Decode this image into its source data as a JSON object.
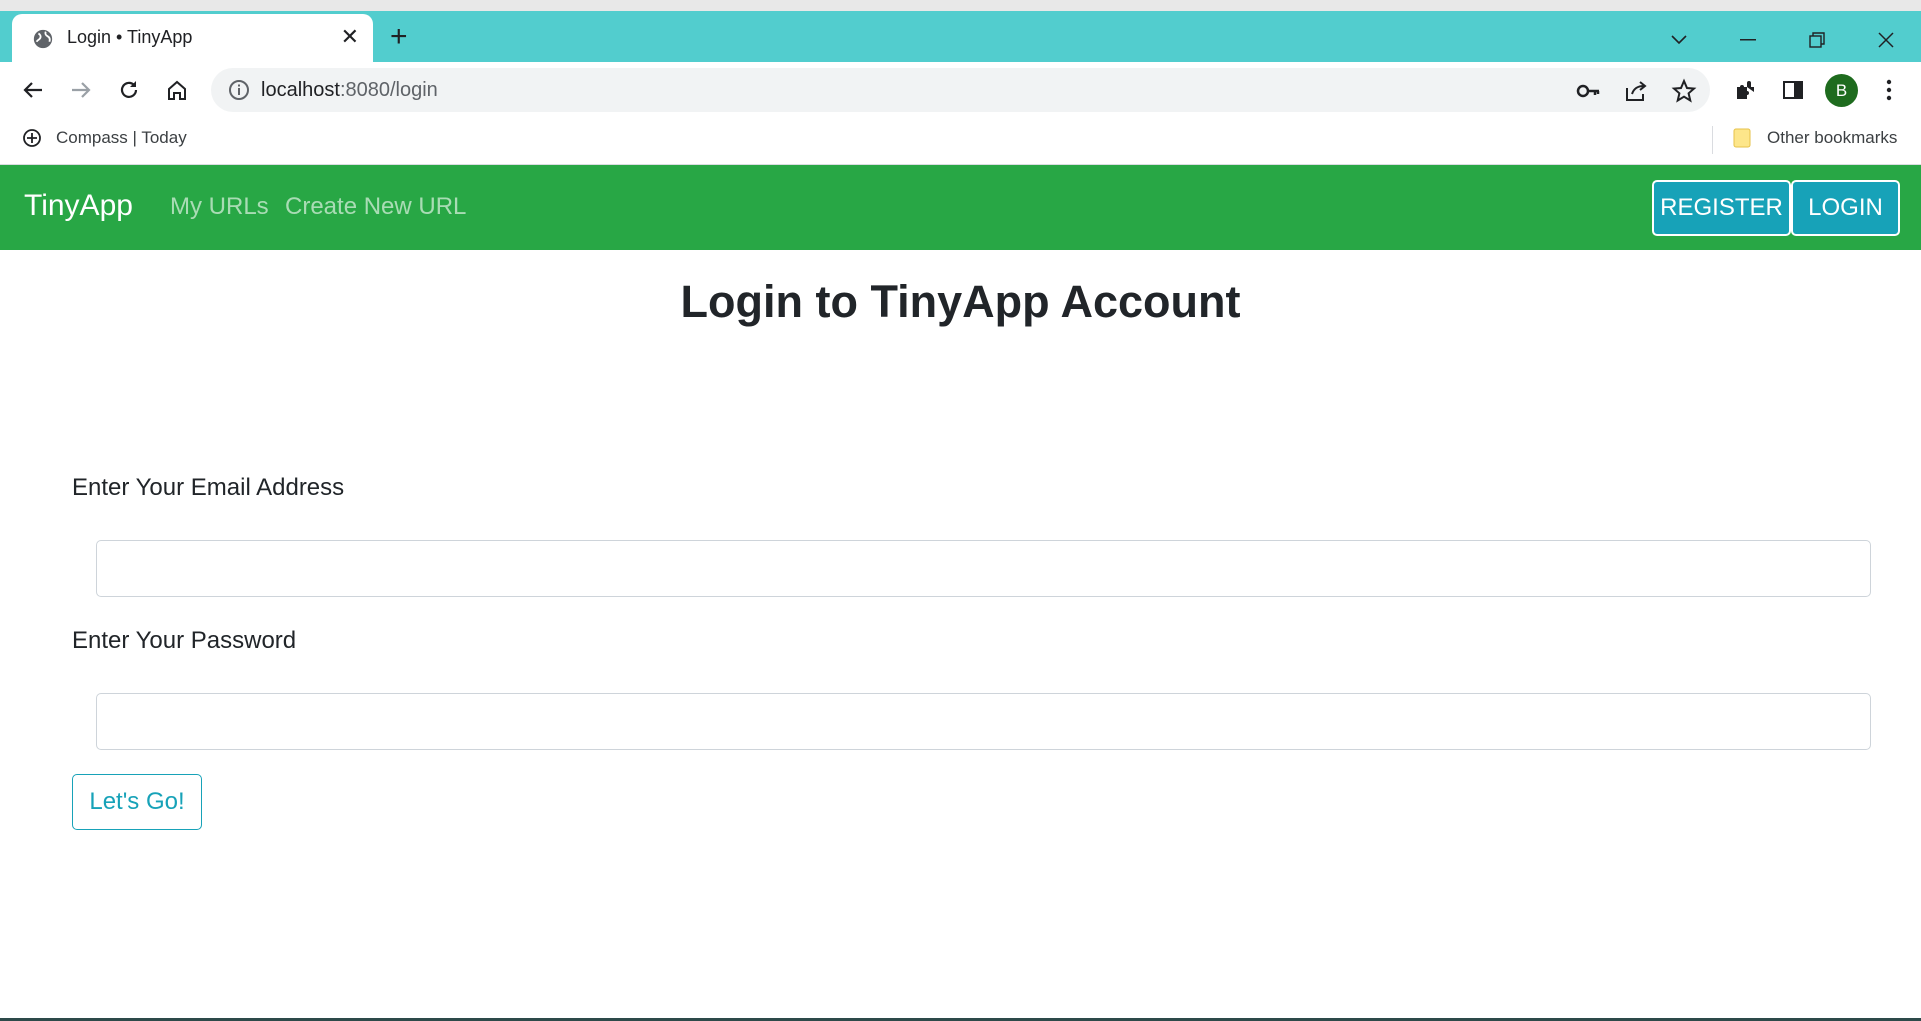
{
  "browser": {
    "tab_title": "Login • TinyApp",
    "url_host": "localhost",
    "url_port_path": ":8080/login",
    "bookmarks": [
      {
        "label": "Compass | Today"
      }
    ],
    "other_bookmarks": "Other bookmarks",
    "profile_initial": "B",
    "tabbar_color": "#52cdce"
  },
  "navbar": {
    "brand": "TinyApp",
    "links": [
      "My URLs",
      "Create New URL"
    ],
    "register_label": "REGISTER",
    "login_label": "LOGIN",
    "color": "#28a745",
    "button_color": "#17a2b8"
  },
  "main": {
    "title": "Login to TinyApp Account",
    "email_label": "Enter Your Email Address",
    "email_value": "",
    "password_label": "Enter Your Password",
    "password_value": "",
    "submit_label": "Let's Go!"
  }
}
